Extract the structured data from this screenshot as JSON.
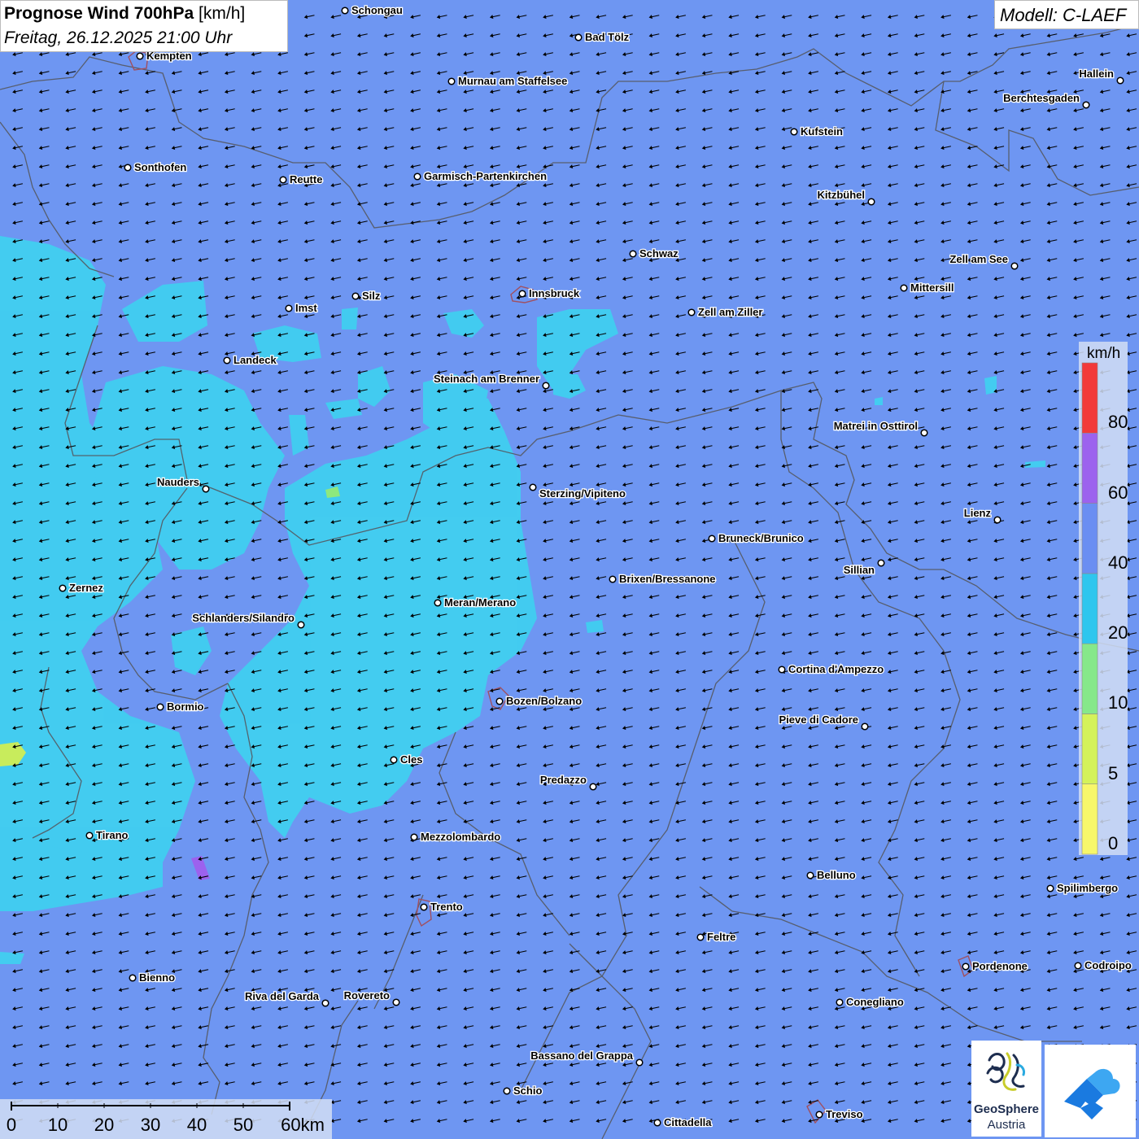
{
  "header": {
    "title_bold": "Prognose Wind 700hPa",
    "title_unit": "[km/h]",
    "datetime": "Freitag, 26.12.2025 21:00 Uhr",
    "model": "Modell: C-LAEF"
  },
  "legend": {
    "unit": "km/h",
    "bands": [
      {
        "label": "0",
        "color": "#f7f76a"
      },
      {
        "label": "5",
        "color": "#d4f25a"
      },
      {
        "label": "10",
        "color": "#86e88a"
      },
      {
        "label": "20",
        "color": "#2ec6ee"
      },
      {
        "label": "40",
        "color": "#6a8ef2"
      },
      {
        "label": "60",
        "color": "#9c62ee"
      },
      {
        "label": "80",
        "color": "#f23a3a"
      }
    ]
  },
  "scale_bar": {
    "labels": [
      "0",
      "10",
      "20",
      "30",
      "40",
      "50",
      "60km"
    ]
  },
  "logo": {
    "name": "GeoSphere",
    "subtitle": "Austria",
    "app_icon": "geosphere-app-icon"
  },
  "colors": {
    "background": "#6e96f2",
    "wind_20_40": "#3fd0f0",
    "wind_10_20": "#8ee87e",
    "wind_60_80": "#9c62ee",
    "border": "#55585f",
    "arrow": "#000000"
  },
  "wind": {
    "direction": "from east-southeast",
    "arrow_icon": "wind-arrow-icon"
  },
  "cities": [
    {
      "name": "Schongau"
    },
    {
      "name": "Bad Tölz"
    },
    {
      "name": "Kempten"
    },
    {
      "name": "Murnau am Staffelsee"
    },
    {
      "name": "Hallein"
    },
    {
      "name": "Berchtesgaden"
    },
    {
      "name": "Kufstein"
    },
    {
      "name": "Sonthofen"
    },
    {
      "name": "Reutte"
    },
    {
      "name": "Garmisch-Partenkirchen"
    },
    {
      "name": "Kitzbühel"
    },
    {
      "name": "Schwaz"
    },
    {
      "name": "Zell am See"
    },
    {
      "name": "Mittersill"
    },
    {
      "name": "Silz"
    },
    {
      "name": "Innsbruck"
    },
    {
      "name": "Imst"
    },
    {
      "name": "Zell am Ziller"
    },
    {
      "name": "Landeck"
    },
    {
      "name": "Steinach am Brenner"
    },
    {
      "name": "Matrei in Osttirol"
    },
    {
      "name": "Nauders"
    },
    {
      "name": "Sterzing/Vipiteno"
    },
    {
      "name": "Lienz"
    },
    {
      "name": "Bruneck/Brunico"
    },
    {
      "name": "Sillian"
    },
    {
      "name": "Zernez"
    },
    {
      "name": "Brixen/Bressanone"
    },
    {
      "name": "Meran/Merano"
    },
    {
      "name": "Schlanders/Silandro"
    },
    {
      "name": "Cortina d'Ampezzo"
    },
    {
      "name": "Bozen/Bolzano"
    },
    {
      "name": "Bormio"
    },
    {
      "name": "Pieve di Cadore"
    },
    {
      "name": "Cles"
    },
    {
      "name": "Predazzo"
    },
    {
      "name": "Tirano"
    },
    {
      "name": "Mezzolombardo"
    },
    {
      "name": "Belluno"
    },
    {
      "name": "Spilimbergo"
    },
    {
      "name": "Trento"
    },
    {
      "name": "Feltre"
    },
    {
      "name": "Pordenone"
    },
    {
      "name": "Codroipo"
    },
    {
      "name": "Bienno"
    },
    {
      "name": "Riva del Garda"
    },
    {
      "name": "Rovereto"
    },
    {
      "name": "Conegliano"
    },
    {
      "name": "Bassano del Grappa"
    },
    {
      "name": "Schio"
    },
    {
      "name": "Treviso"
    },
    {
      "name": "Cittadella"
    }
  ]
}
